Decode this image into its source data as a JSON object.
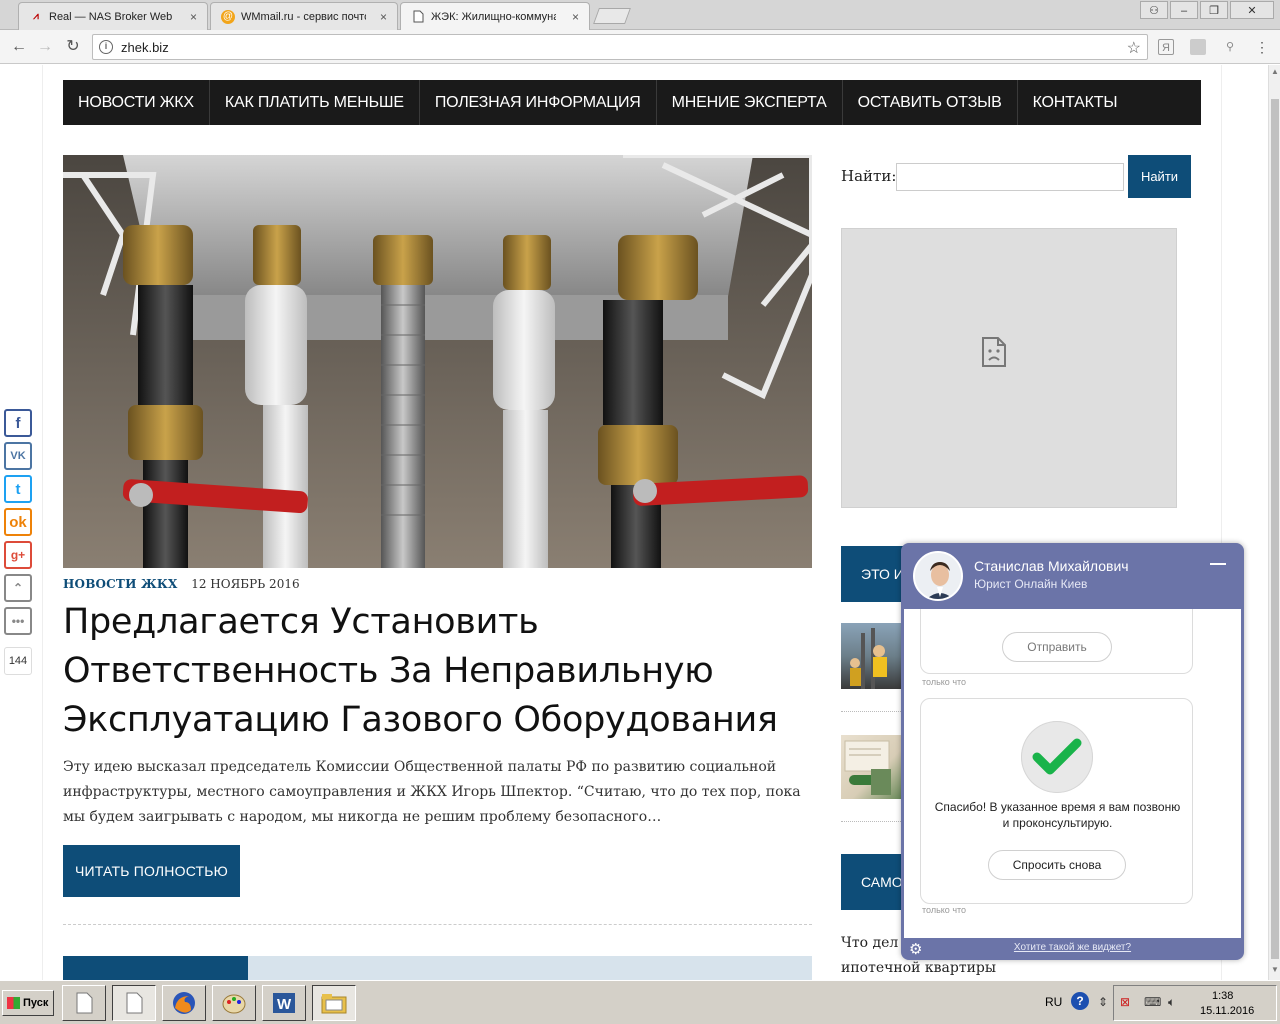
{
  "browser": {
    "tabs": [
      {
        "title": "Real — NAS Broker Web MT",
        "icon": "broker-icon"
      },
      {
        "title": "WMmail.ru - сервис почтов",
        "icon": "wmmail-icon"
      },
      {
        "title": "ЖЭК: Жилищно-коммунал",
        "icon": "page-icon",
        "active": true
      }
    ],
    "url": "zhek.biz"
  },
  "site": {
    "nav": [
      "НОВОСТИ ЖКХ",
      "КАК ПЛАТИТЬ МЕНЬШЕ",
      "ПОЛЕЗНАЯ ИНФОРМАЦИЯ",
      "МНЕНИЕ ЭКСПЕРТА",
      "ОСТАВИТЬ ОТЗЫВ",
      "КОНТАКТЫ"
    ],
    "article": {
      "category": "НОВОСТИ ЖКХ",
      "date": "12 НОЯБРЬ 2016",
      "title": "Предлагается Установить Ответственность За Неправильную Эксплуатацию Газового Оборудования",
      "excerpt": "Эту идею высказал председатель Комиссии Общественной палаты РФ по развитию социальной инфраструктуры, местного самоуправления и ЖКХ Игорь Шпектор. “Считаю, что до тех пор, пока мы будем заигрывать с народом, мы никогда не решим проблему безопасного…",
      "read_more": "ЧИТАТЬ ПОЛНОСТЬЮ"
    },
    "sidebar": {
      "search_label": "Найти:",
      "search_button": "Найти",
      "search_value": "",
      "section1_head": "ЭТО И",
      "section2_head": "САМО",
      "bottom_text_1": "Что дел",
      "bottom_text_2": "ипотечной квартиры"
    },
    "social": {
      "share_count": "144",
      "buttons": [
        "facebook-icon",
        "vk-icon",
        "twitter-icon",
        "odnoklassniki-icon",
        "google-plus-icon",
        "scroll-up-icon",
        "more-icon"
      ]
    }
  },
  "chat": {
    "agent_name": "Станислав Михайлович",
    "agent_role": "Юрист Онлайн Киев",
    "send_button": "Отправить",
    "timestamp_1": "только что",
    "thanks_text": "Спасибо! В указанное время я вам позвоню и проконсультирую.",
    "ask_again_button": "Спросить снова",
    "timestamp_2": "только что",
    "footer_link": "Хотите такой же виджет?"
  },
  "taskbar": {
    "start_label": "Пуск",
    "language": "RU",
    "time": "1:38",
    "date": "15.11.2016"
  },
  "colors": {
    "accent": "#0e4d78",
    "nav_bg": "#1a1a1a",
    "chat_bg": "#6b74a8"
  }
}
